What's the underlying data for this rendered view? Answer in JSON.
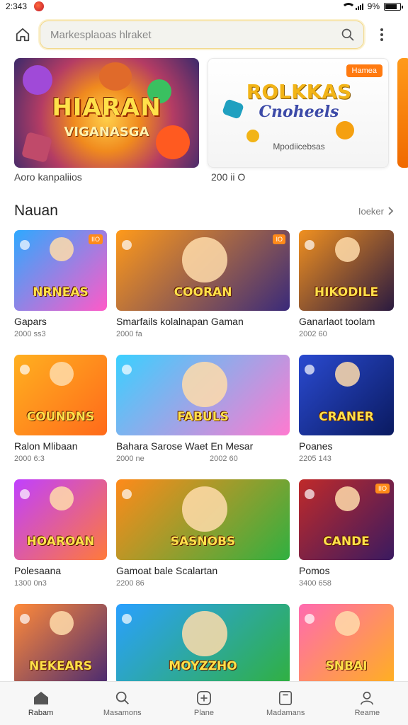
{
  "status_bar": {
    "time": "2:343",
    "battery_text": "9%"
  },
  "search": {
    "placeholder": "Markesplaoas hlraket"
  },
  "featured": [
    {
      "title": "HIARAN",
      "subtitle": "VIGANASGA",
      "label": "Aoro kanpaliios",
      "colors": [
        "#ffcf4a",
        "#b43c64"
      ]
    },
    {
      "title": "ROLKKAS",
      "subtitle": "Cnoheels",
      "caption": "Mpodiicebsas",
      "badge": "Hamea",
      "label": "200 ii O"
    }
  ],
  "section": {
    "title": "Nauan",
    "see_all": "Ioeker"
  },
  "games": [
    {
      "name": "Gapars",
      "meta": "2000 ss3",
      "thumb_text": "NRNEAS",
      "bg": [
        "#2ea9ff",
        "#ff5ac8"
      ],
      "tag": "IIO"
    },
    {
      "name": "Smarfails kolalnapan Gaman",
      "meta": "2000 fa",
      "thumb_text": "COORAN",
      "bg": [
        "#ff9a1a",
        "#3a2a7a"
      ],
      "tag": "IO"
    },
    {
      "name": "Ganarlaot toolam",
      "meta": "2002 60",
      "thumb_text": "HIKODILE",
      "bg": [
        "#f09020",
        "#2a1a40"
      ]
    },
    {
      "name": "Ralon Mlibaan",
      "meta": "2000 6:3",
      "thumb_text": "COUNDNS",
      "bg": [
        "#ffb020",
        "#ff6a1a"
      ]
    },
    {
      "name": "Bahara Sarose Waet En Mesar",
      "meta": "2000 ne",
      "meta2": "2002 60",
      "thumb_text": "FABULS",
      "bg": [
        "#3ad0ff",
        "#ff7ad0"
      ]
    },
    {
      "name": "Poanes",
      "meta": "2205 143",
      "thumb_text": "CRANER",
      "bg": [
        "#2a4ad0",
        "#0a1a60"
      ]
    },
    {
      "name": "Polesaana",
      "meta": "1300 0n3",
      "thumb_text": "HOAROAN",
      "bg": [
        "#c040ff",
        "#ff7a3a"
      ]
    },
    {
      "name": "Gamoat bale Scalartan",
      "meta": "2200 86",
      "thumb_text": "SASNOBS",
      "bg": [
        "#ff8a1a",
        "#30b040"
      ]
    },
    {
      "name": "Pomos",
      "meta": "3400 658",
      "thumb_text": "CANDE",
      "bg": [
        "#c02a2a",
        "#3a1a60"
      ],
      "tag": "IIO"
    },
    {
      "name": "",
      "meta": "",
      "thumb_text": "NEKEARS",
      "bg": [
        "#ff8a3a",
        "#4a2a70"
      ]
    },
    {
      "name": "",
      "meta": "",
      "thumb_text": "MOYZZHO",
      "bg": [
        "#2aa0ff",
        "#30b040"
      ]
    },
    {
      "name": "",
      "meta": "",
      "thumb_text": "SNBAI",
      "bg": [
        "#ff6ab0",
        "#ffb020"
      ]
    }
  ],
  "nav": [
    {
      "label": "Rabam",
      "icon": "home-icon"
    },
    {
      "label": "Masamons",
      "icon": "search-icon"
    },
    {
      "label": "Plane",
      "icon": "add-icon"
    },
    {
      "label": "Madamans",
      "icon": "library-icon"
    },
    {
      "label": "Reame",
      "icon": "profile-icon"
    }
  ]
}
